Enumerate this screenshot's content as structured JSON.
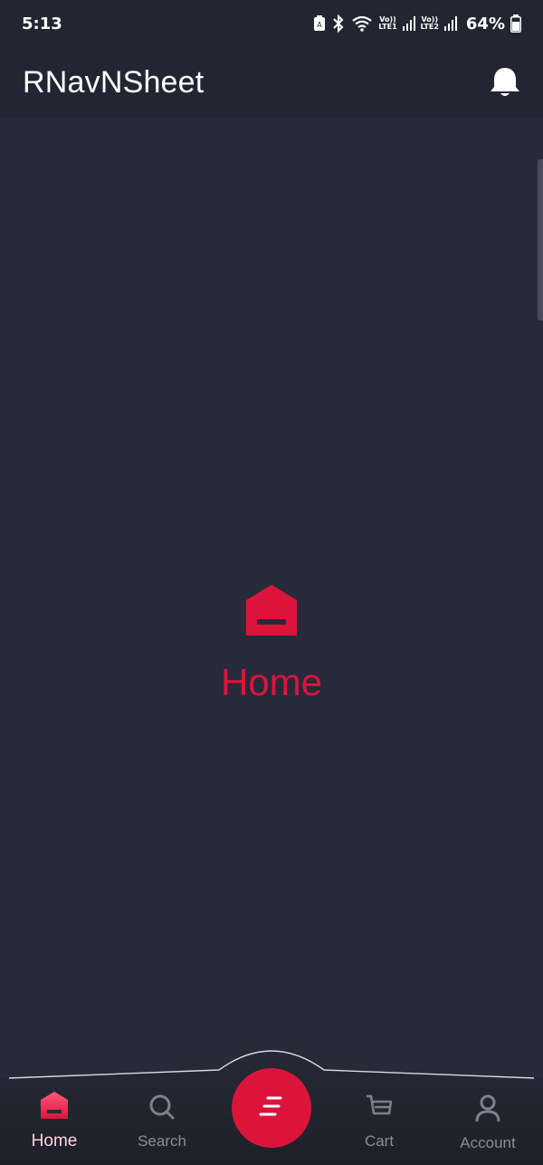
{
  "status_bar": {
    "time": "5:13",
    "network_1": "Vo)) LTE1",
    "network_1_top": "Vo))",
    "network_1_bottom": "LTE1",
    "network_2": "Vo)) LTE2",
    "network_2_top": "Vo))",
    "network_2_bottom": "LTE2",
    "battery": "64%",
    "icons": [
      "battery-saver-icon",
      "bluetooth-icon",
      "wifi-icon",
      "signal-icon",
      "battery-icon"
    ]
  },
  "app_bar": {
    "title": "RNavNSheet",
    "action_icon": "bell-icon"
  },
  "main": {
    "icon": "home-icon",
    "label": "Home"
  },
  "bottom_nav": {
    "items": [
      {
        "label": "Home",
        "icon": "home-icon",
        "active": true
      },
      {
        "label": "Search",
        "icon": "search-icon",
        "active": false
      },
      {
        "label": "Cart",
        "icon": "cart-icon",
        "active": false
      },
      {
        "label": "Account",
        "icon": "account-icon",
        "active": false
      }
    ],
    "fab_icon": "menu-icon"
  },
  "colors": {
    "accent": "#dc143c",
    "background": "#272a38",
    "bar_background": "#232632",
    "inactive": "#8a8d98",
    "active_label": "#ffd2db"
  }
}
